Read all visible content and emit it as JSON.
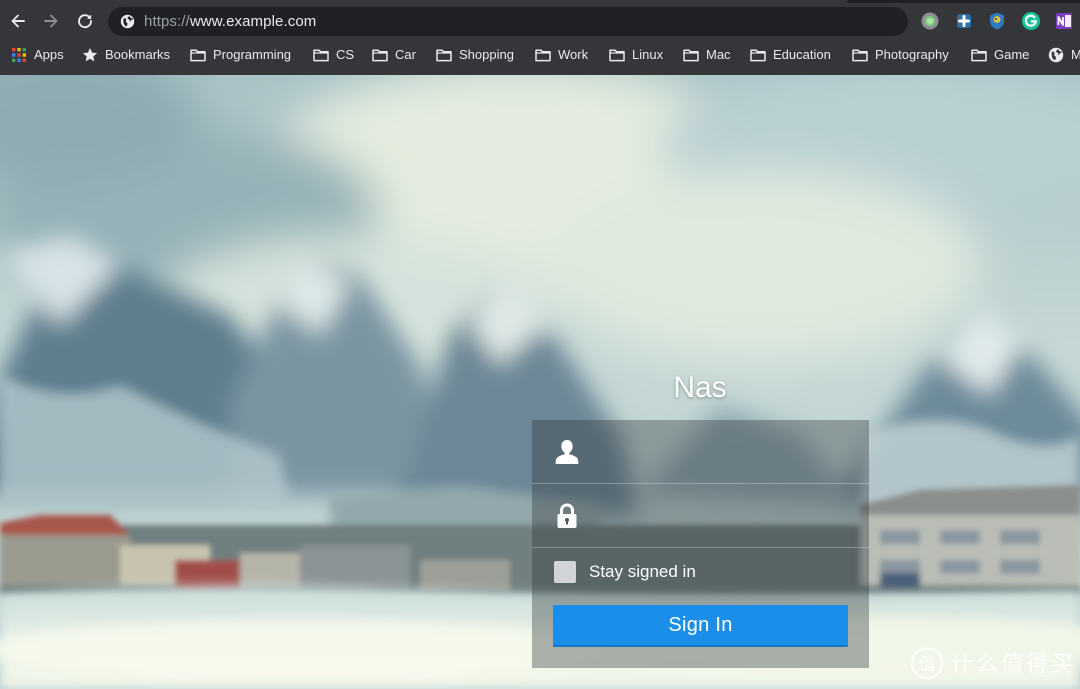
{
  "browser": {
    "url_scheme": "https://",
    "url_host": "www.example.com",
    "bookmarks": [
      {
        "label": "Apps",
        "icon": "apps-grid-icon"
      },
      {
        "label": "Bookmarks",
        "icon": "star-icon"
      },
      {
        "label": "Programming",
        "icon": "folder-icon"
      },
      {
        "label": "CS",
        "icon": "folder-icon"
      },
      {
        "label": "Car",
        "icon": "folder-icon"
      },
      {
        "label": "Shopping",
        "icon": "folder-icon"
      },
      {
        "label": "Work",
        "icon": "folder-icon"
      },
      {
        "label": "Linux",
        "icon": "folder-icon"
      },
      {
        "label": "Mac",
        "icon": "folder-icon"
      },
      {
        "label": "Education",
        "icon": "folder-icon"
      },
      {
        "label": "Photography",
        "icon": "folder-icon"
      },
      {
        "label": "Game",
        "icon": "folder-icon"
      },
      {
        "label": "M",
        "icon": "globe-icon"
      }
    ],
    "colors": {
      "toolbar": "#35363a",
      "omnibox": "#202124",
      "text": "#e8eaed"
    }
  },
  "login": {
    "title": "Nas",
    "username_placeholder": "",
    "password_placeholder": "",
    "stay_signed_in": "Stay signed in",
    "sign_in": "Sign In",
    "accent_color": "#1a8ee8"
  },
  "watermark": {
    "text": "什么值得买"
  }
}
